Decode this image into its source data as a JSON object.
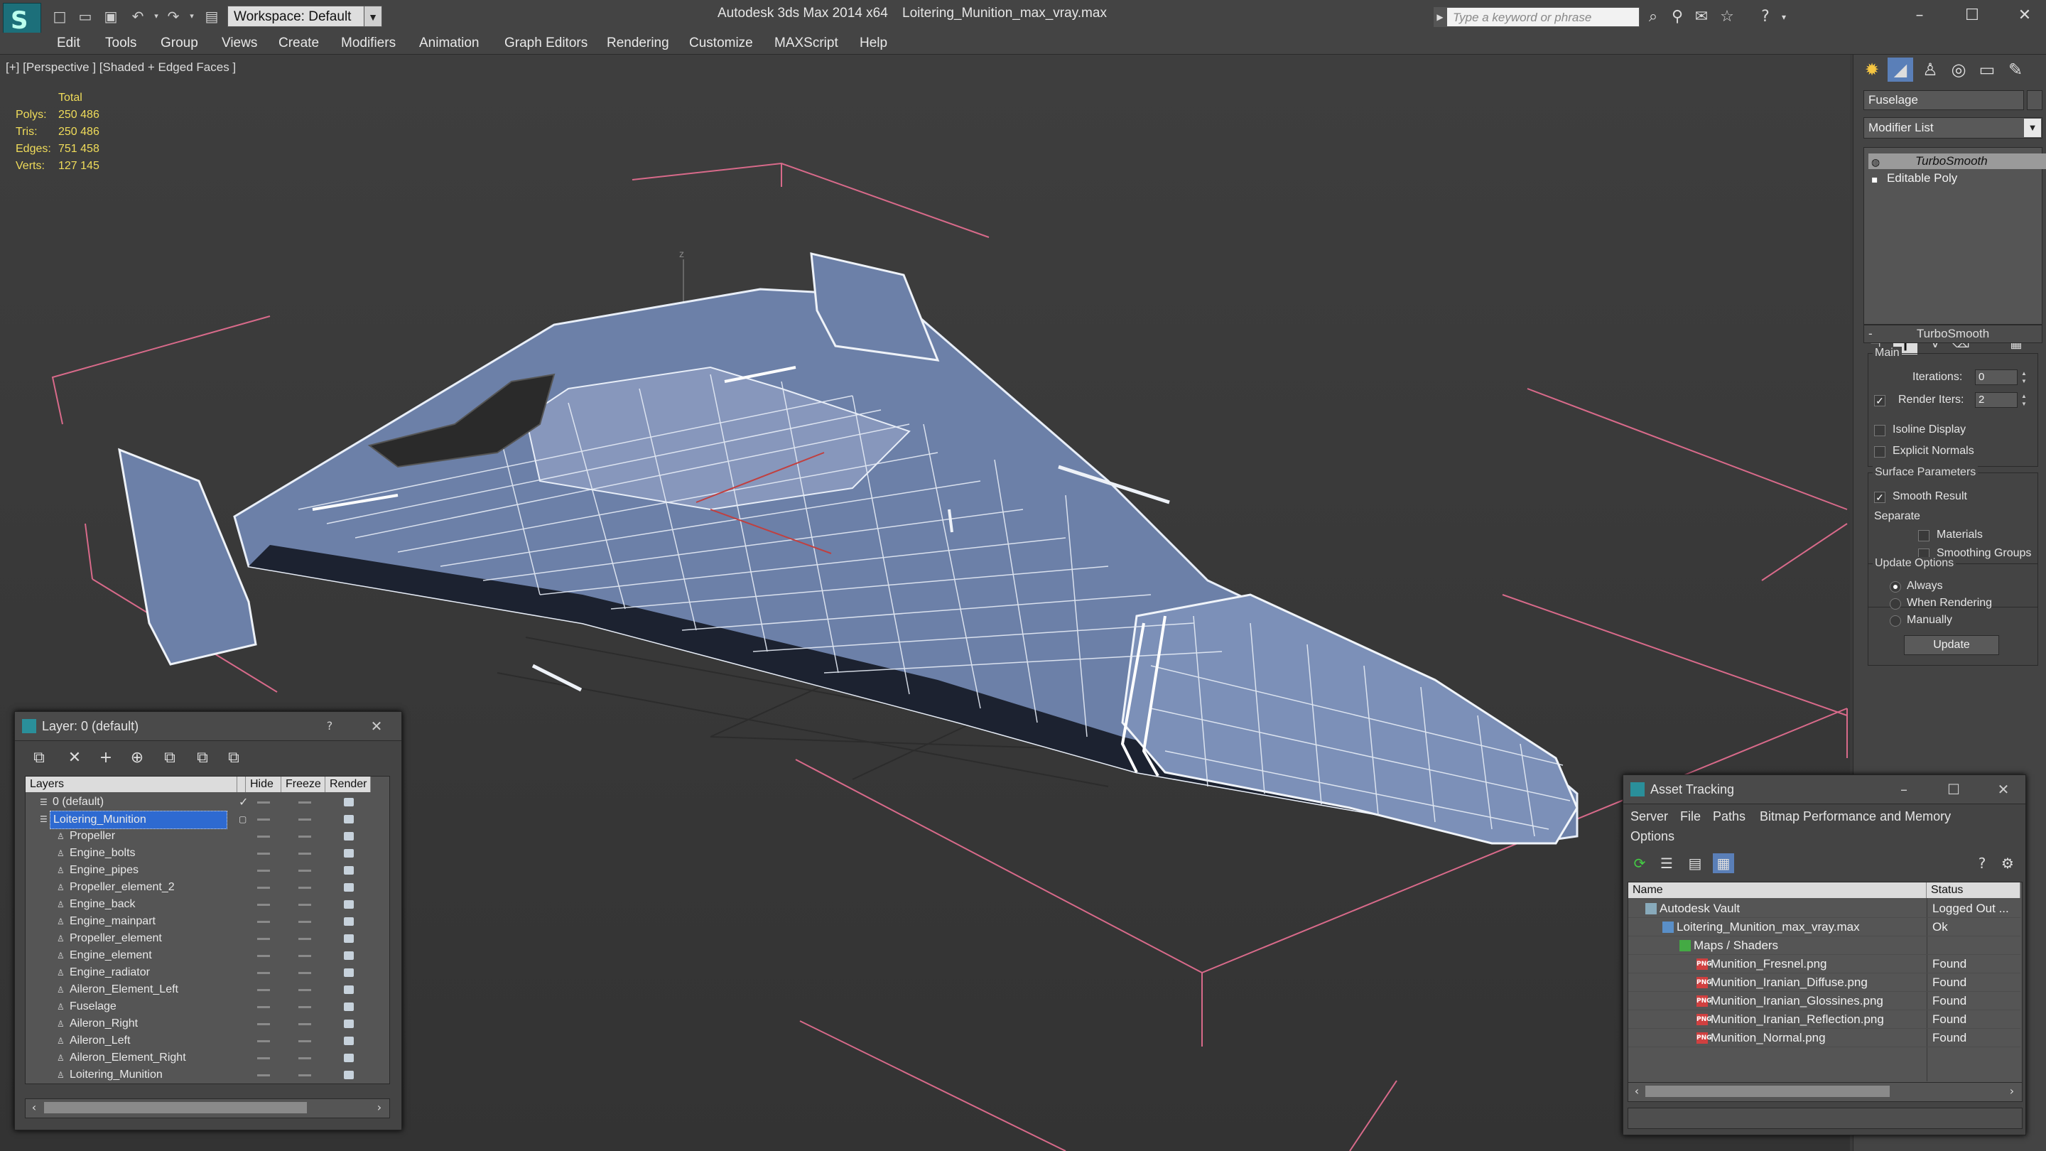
{
  "titlebar": {
    "workspace": "Workspace: Default",
    "app_title": "Autodesk 3ds Max  2014 x64",
    "file_name": "Loitering_Munition_max_vray.max",
    "search_placeholder": "Type a keyword or phrase"
  },
  "menu": [
    "Edit",
    "Tools",
    "Group",
    "Views",
    "Create",
    "Modifiers",
    "Animation",
    "Graph Editors",
    "Rendering",
    "Customize",
    "MAXScript",
    "Help"
  ],
  "viewport": {
    "label": "[+] [Perspective ] [Shaded + Edged Faces ]",
    "stats": {
      "header": "Total",
      "rows": [
        {
          "label": "Polys:",
          "value": "250 486"
        },
        {
          "label": "Tris:",
          "value": "250 486"
        },
        {
          "label": "Edges:",
          "value": "751 458"
        },
        {
          "label": "Verts:",
          "value": "127 145"
        }
      ]
    },
    "axis_label": "z"
  },
  "command_panel": {
    "object_name": "Fuselage",
    "modifier_list": "Modifier List",
    "stack": [
      "TurboSmooth",
      "Editable Poly"
    ],
    "rollout_title": "TurboSmooth",
    "main_group": "Main",
    "iterations_label": "Iterations:",
    "iterations_value": "0",
    "render_iters_label": "Render Iters:",
    "render_iters_value": "2",
    "isoline_display": "Isoline Display",
    "explicit_normals": "Explicit Normals",
    "surface_group": "Surface Parameters",
    "smooth_result": "Smooth Result",
    "separate": "Separate",
    "materials": "Materials",
    "smoothing_groups": "Smoothing Groups",
    "update_group": "Update Options",
    "always": "Always",
    "when_rendering": "When Rendering",
    "manually": "Manually",
    "update_button": "Update"
  },
  "layer_window": {
    "title": "Layer: 0 (default)",
    "help": "?",
    "columns": [
      "Layers",
      "Hide",
      "Freeze",
      "Render"
    ],
    "rows": [
      {
        "name": "0 (default)",
        "level": 0
      },
      {
        "name": "Loitering_Munition",
        "level": 0
      },
      {
        "name": "Propeller",
        "level": 1
      },
      {
        "name": "Engine_bolts",
        "level": 1
      },
      {
        "name": "Engine_pipes",
        "level": 1
      },
      {
        "name": "Propeller_element_2",
        "level": 1
      },
      {
        "name": "Engine_back",
        "level": 1
      },
      {
        "name": "Engine_mainpart",
        "level": 1
      },
      {
        "name": "Propeller_element",
        "level": 1
      },
      {
        "name": "Engine_element",
        "level": 1
      },
      {
        "name": "Engine_radiator",
        "level": 1
      },
      {
        "name": "Aileron_Element_Left",
        "level": 1
      },
      {
        "name": "Fuselage",
        "level": 1
      },
      {
        "name": "Aileron_Right",
        "level": 1
      },
      {
        "name": "Aileron_Left",
        "level": 1
      },
      {
        "name": "Aileron_Element_Right",
        "level": 1
      },
      {
        "name": "Loitering_Munition",
        "level": 1
      }
    ]
  },
  "asset_window": {
    "title": "Asset Tracking",
    "menu": [
      "Server",
      "File",
      "Paths",
      "Bitmap Performance and Memory",
      "Options"
    ],
    "columns": [
      "Name",
      "Status"
    ],
    "rows": [
      {
        "name": "Autodesk Vault",
        "status": "Logged Out ...",
        "level": 0,
        "icon": "vault"
      },
      {
        "name": "Loitering_Munition_max_vray.max",
        "status": "Ok",
        "level": 1,
        "icon": "max"
      },
      {
        "name": "Maps / Shaders",
        "status": "",
        "level": 2,
        "icon": "maps"
      },
      {
        "name": "Munition_Fresnel.png",
        "status": "Found",
        "level": 3,
        "icon": "png"
      },
      {
        "name": "Munition_Iranian_Diffuse.png",
        "status": "Found",
        "level": 3,
        "icon": "png"
      },
      {
        "name": "Munition_Iranian_Glossines.png",
        "status": "Found",
        "level": 3,
        "icon": "png"
      },
      {
        "name": "Munition_Iranian_Reflection.png",
        "status": "Found",
        "level": 3,
        "icon": "png"
      },
      {
        "name": "Munition_Normal.png",
        "status": "Found",
        "level": 3,
        "icon": "png"
      }
    ],
    "png_badge": "PNG"
  }
}
